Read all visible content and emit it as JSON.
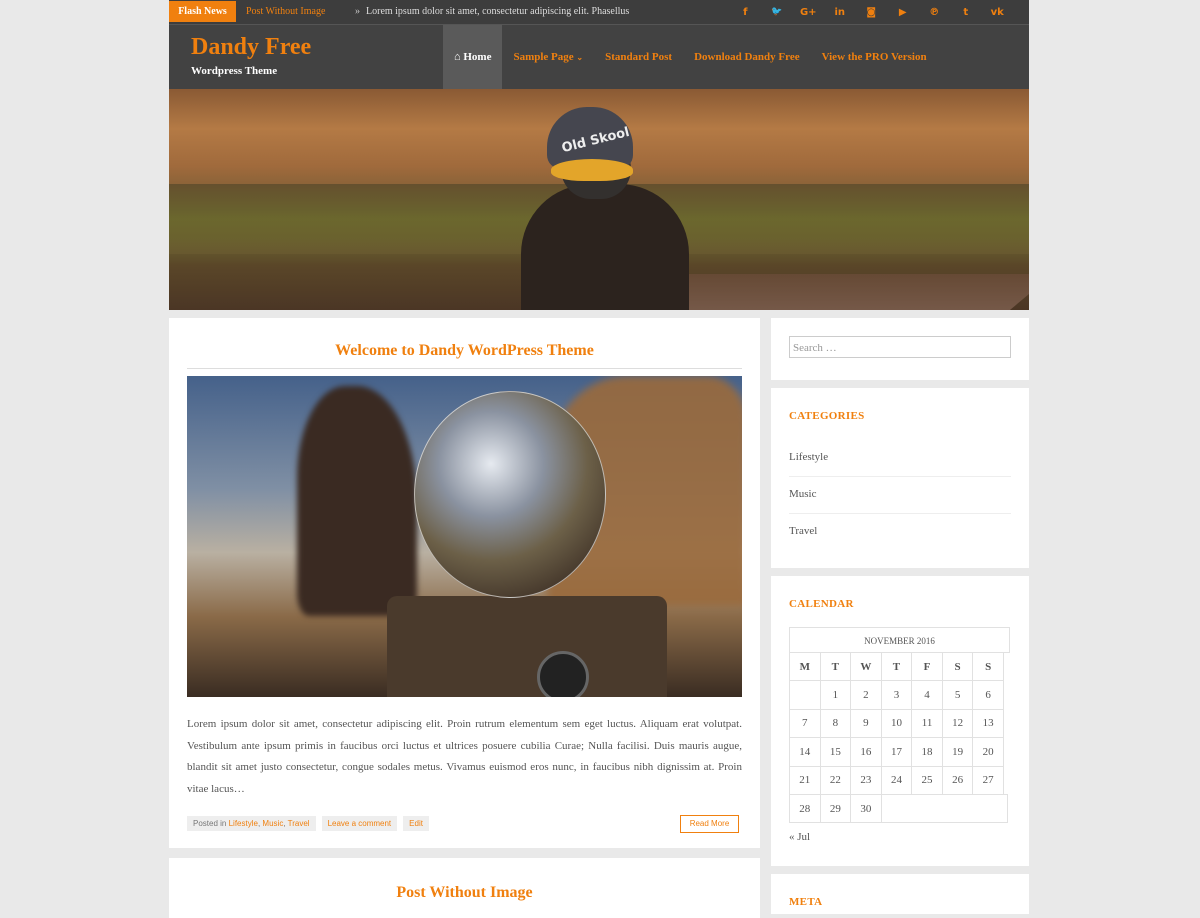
{
  "topbar": {
    "flash_label": "Flash News",
    "flash_link": "Post Without Image",
    "flash_arrow": "»",
    "flash_text": "Lorem ipsum dolor sit amet, consectetur adipiscing elit. Phasellus",
    "social_icons": [
      {
        "name": "facebook-icon",
        "glyph": "f"
      },
      {
        "name": "twitter-icon",
        "glyph": "🐦"
      },
      {
        "name": "google-plus-icon",
        "glyph": "G+"
      },
      {
        "name": "linkedin-icon",
        "glyph": "in"
      },
      {
        "name": "instagram-icon",
        "glyph": "◙"
      },
      {
        "name": "youtube-icon",
        "glyph": "▶"
      },
      {
        "name": "pinterest-icon",
        "glyph": "℗"
      },
      {
        "name": "tumblr-icon",
        "glyph": "t"
      },
      {
        "name": "vk-icon",
        "glyph": "vk"
      }
    ]
  },
  "header": {
    "site_title": "Dandy Free",
    "site_description": "Wordpress Theme",
    "nav": {
      "home": "Home",
      "sample_page": "Sample Page",
      "standard_post": "Standard Post",
      "download": "Download Dandy Free",
      "pro": "View the PRO Version"
    },
    "home_icon": "⌂",
    "caret": "⌄"
  },
  "hero": {
    "cap_text": "Old Skool"
  },
  "post": {
    "title": "Welcome to Dandy WordPress Theme",
    "excerpt": "Lorem ipsum dolor sit amet, consectetur adipiscing elit. Proin rutrum elementum sem eget luctus. Aliquam erat volutpat. Vestibulum ante ipsum primis in faucibus orci luctus et ultrices posuere cubilia Curae; Nulla facilisi. Duis mauris augue, blandit sit amet justo consectetur, congue sodales metus. Vivamus euismod eros nunc, in faucibus nibh dignissim at. Proin vitae lacus…",
    "meta": {
      "posted_in": "Posted in",
      "cat1": "Lifestyle",
      "sep1": ",",
      "cat2": "Music",
      "sep2": ",",
      "cat3": "Travel",
      "comment": "Leave a comment",
      "edit": "Edit"
    },
    "read_more": "Read More"
  },
  "post2": {
    "title": "Post Without Image"
  },
  "sidebar": {
    "search_placeholder": "Search …",
    "categories": {
      "title": "CATEGORIES",
      "items": [
        "Lifestyle",
        "Music",
        "Travel"
      ]
    },
    "calendar": {
      "title": "CALENDAR",
      "caption": "NOVEMBER 2016",
      "days": [
        "M",
        "T",
        "W",
        "T",
        "F",
        "S",
        "S"
      ],
      "rows": [
        [
          "",
          "1",
          "2",
          "3",
          "4",
          "5",
          "6"
        ],
        [
          "7",
          "8",
          "9",
          "10",
          "11",
          "12",
          "13"
        ],
        [
          "14",
          "15",
          "16",
          "17",
          "18",
          "19",
          "20"
        ],
        [
          "21",
          "22",
          "23",
          "24",
          "25",
          "26",
          "27"
        ],
        [
          "28",
          "29",
          "30"
        ]
      ],
      "prev": "« Jul"
    },
    "meta_title": "META"
  }
}
